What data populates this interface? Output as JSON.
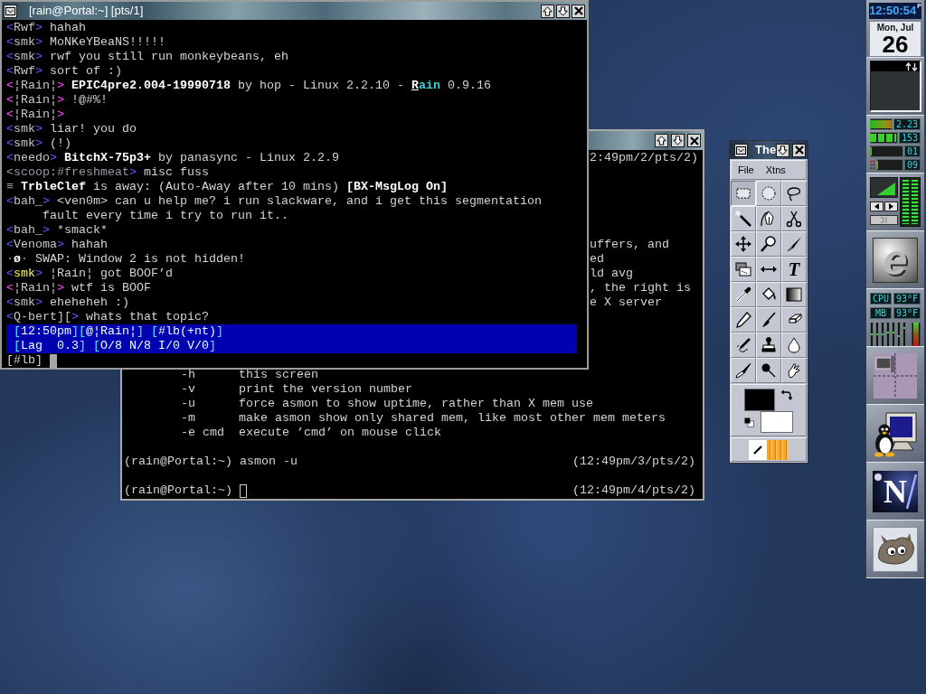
{
  "back_terminal": {
    "focused": false,
    "rows": [
      {
        "kind": "fragment",
        "text": "2:49pm/2/pts/2)"
      },
      {
        "kind": "blank"
      },
      {
        "kind": "blank"
      },
      {
        "kind": "blank"
      },
      {
        "kind": "blank"
      },
      {
        "kind": "blank"
      },
      {
        "kind": "fragment",
        "text": "uffers, and"
      },
      {
        "kind": "fragment",
        "text": "ed"
      },
      {
        "kind": "fragment",
        "text": "ld avg"
      },
      {
        "kind": "fragment",
        "text": ", the right is"
      },
      {
        "kind": "fragment",
        "text": "e X server"
      },
      {
        "kind": "blank"
      },
      {
        "kind": "blank"
      },
      {
        "kind": "blank"
      },
      {
        "kind": "blank"
      },
      {
        "kind": "option",
        "option": "-h",
        "description": "this screen"
      },
      {
        "kind": "option",
        "option": "-v",
        "description": "print the version number"
      },
      {
        "kind": "option",
        "option": "-u",
        "description": "force asmon to show uptime, rather than X mem use"
      },
      {
        "kind": "option",
        "option": "-m",
        "description": "make asmon show only shared mem, like most other mem meters"
      },
      {
        "kind": "option",
        "option": "-e cmd",
        "description": "execute ’cmd’ on mouse click"
      },
      {
        "kind": "blank"
      },
      {
        "kind": "prompt",
        "prompt": "(rain@Portal:~)",
        "command": "asmon -u",
        "info": "(12:49pm/3/pts/2)"
      },
      {
        "kind": "blank"
      },
      {
        "kind": "prompt",
        "prompt": "(rain@Portal:~)",
        "info": "(12:49pm/4/pts/2)"
      }
    ]
  },
  "front_terminal": {
    "title": "[rain@Portal:~] [pts/1]",
    "focused": true,
    "lines": [
      {
        "kind": "message",
        "segments": [
          {
            "text": "<",
            "kind": "bracket"
          },
          {
            "text": "Rwf",
            "kind": "nick"
          },
          {
            "text": ">",
            "kind": "bracket"
          },
          {
            "text": " hahah",
            "kind": "plain"
          }
        ]
      },
      {
        "kind": "message",
        "segments": [
          {
            "text": "<",
            "kind": "bracket"
          },
          {
            "text": "smk",
            "kind": "nick"
          },
          {
            "text": ">",
            "kind": "bracket"
          },
          {
            "text": " MoNKeYBeaNS!!!!!",
            "kind": "plain"
          }
        ]
      },
      {
        "kind": "message",
        "segments": [
          {
            "text": "<",
            "kind": "bracket"
          },
          {
            "text": "smk",
            "kind": "nick"
          },
          {
            "text": ">",
            "kind": "bracket"
          },
          {
            "text": " rwf you still run monkeybeans, eh",
            "kind": "plain"
          }
        ]
      },
      {
        "kind": "message",
        "segments": [
          {
            "text": "<",
            "kind": "bracket"
          },
          {
            "text": "Rwf",
            "kind": "nick"
          },
          {
            "text": ">",
            "kind": "bracket"
          },
          {
            "text": " sort of :)",
            "kind": "plain"
          }
        ]
      },
      {
        "kind": "message",
        "segments": [
          {
            "text": "<",
            "kind": "own_bracket"
          },
          {
            "text": "¦Rain¦",
            "kind": "nick"
          },
          {
            "text": ">",
            "kind": "own_bracket"
          },
          {
            "text": " EPIC4pre2.004-19990718",
            "kind": "bold"
          },
          {
            "text": " by hop - Linux 2.2.10 - ",
            "kind": "plain"
          },
          {
            "text": "R",
            "kind": "underline"
          },
          {
            "text": "ain",
            "kind": "accent"
          },
          {
            "text": " 0.9.16",
            "kind": "plain"
          }
        ]
      },
      {
        "kind": "message",
        "segments": [
          {
            "text": "<",
            "kind": "own_bracket"
          },
          {
            "text": "¦Rain¦",
            "kind": "nick"
          },
          {
            "text": ">",
            "kind": "own_bracket"
          },
          {
            "text": " !@#%!",
            "kind": "plain"
          }
        ]
      },
      {
        "kind": "message",
        "segments": [
          {
            "text": "<",
            "kind": "own_bracket"
          },
          {
            "text": "¦Rain¦",
            "kind": "nick"
          },
          {
            "text": ">",
            "kind": "own_bracket"
          }
        ]
      },
      {
        "kind": "message",
        "segments": [
          {
            "text": "<",
            "kind": "bracket"
          },
          {
            "text": "smk",
            "kind": "nick"
          },
          {
            "text": ">",
            "kind": "bracket"
          },
          {
            "text": " liar! you do",
            "kind": "plain"
          }
        ]
      },
      {
        "kind": "message",
        "segments": [
          {
            "text": "<",
            "kind": "bracket"
          },
          {
            "text": "smk",
            "kind": "nick"
          },
          {
            "text": ">",
            "kind": "bracket"
          },
          {
            "text": " (!)",
            "kind": "plain"
          }
        ]
      },
      {
        "kind": "message",
        "segments": [
          {
            "text": "<",
            "kind": "bracket"
          },
          {
            "text": "needo",
            "kind": "nick"
          },
          {
            "text": ">",
            "kind": "bracket"
          },
          {
            "text": " BitchX-75p3+",
            "kind": "bold"
          },
          {
            "text": " by panasync - Linux 2.2.9",
            "kind": "plain"
          }
        ]
      },
      {
        "kind": "message",
        "segments": [
          {
            "text": "<scoop:#freshmeat",
            "kind": "dim"
          },
          {
            "text": ">",
            "kind": "bracket"
          },
          {
            "text": " misc fuss",
            "kind": "plain"
          }
        ]
      },
      {
        "kind": "message",
        "segments": [
          {
            "text": "≡",
            "kind": "dim"
          },
          {
            "text": " TrbleClef",
            "kind": "bold"
          },
          {
            "text": " is away: (Auto-Away after 10 mins) ",
            "kind": "plain"
          },
          {
            "text": "[BX-MsgLog On]",
            "kind": "bold"
          }
        ]
      },
      {
        "kind": "message",
        "segments": [
          {
            "text": "<",
            "kind": "bracket"
          },
          {
            "text": "bah_",
            "kind": "nick"
          },
          {
            "text": ">",
            "kind": "bracket"
          },
          {
            "text": " <ven0m> can u help me? i run slackware, and i get this segmentation",
            "kind": "plain"
          }
        ]
      },
      {
        "kind": "wrap",
        "segments": [
          {
            "text": "fault every time i try to run it..",
            "kind": "plain"
          }
        ]
      },
      {
        "kind": "message",
        "segments": [
          {
            "text": "<",
            "kind": "bracket"
          },
          {
            "text": "bah_",
            "kind": "nick"
          },
          {
            "text": ">",
            "kind": "bracket"
          },
          {
            "text": " *smack*",
            "kind": "plain"
          }
        ]
      },
      {
        "kind": "message",
        "segments": [
          {
            "text": "<",
            "kind": "bracket"
          },
          {
            "text": "Venoma",
            "kind": "nick"
          },
          {
            "text": ">",
            "kind": "bracket"
          },
          {
            "text": " hahah",
            "kind": "plain"
          }
        ]
      },
      {
        "kind": "message",
        "segments": [
          {
            "text": "·",
            "kind": "dim"
          },
          {
            "text": "ø",
            "kind": "bold"
          },
          {
            "text": "·",
            "kind": "dim"
          },
          {
            "text": " SWAP: Window 2 is not hidden!",
            "kind": "plain"
          }
        ]
      },
      {
        "kind": "message",
        "segments": [
          {
            "text": "<",
            "kind": "bracket"
          },
          {
            "text": "smk",
            "kind": "highlight"
          },
          {
            "text": ">",
            "kind": "bracket"
          },
          {
            "text": " ¦Rain¦ got BOOF’d",
            "kind": "plain"
          }
        ]
      },
      {
        "kind": "message",
        "segments": [
          {
            "text": "<",
            "kind": "own_bracket"
          },
          {
            "text": "¦Rain¦",
            "kind": "nick"
          },
          {
            "text": ">",
            "kind": "own_bracket"
          },
          {
            "text": " wtf is BOOF",
            "kind": "plain"
          }
        ]
      },
      {
        "kind": "message",
        "segments": [
          {
            "text": "<",
            "kind": "bracket"
          },
          {
            "text": "smk",
            "kind": "nick"
          },
          {
            "text": ">",
            "kind": "bracket"
          },
          {
            "text": " eheheheh :)",
            "kind": "plain"
          }
        ]
      },
      {
        "kind": "message",
        "segments": [
          {
            "text": "<",
            "kind": "bracket"
          },
          {
            "text": "Q-bert][",
            "kind": "nick"
          },
          {
            "text": ">",
            "kind": "bracket"
          },
          {
            "text": " whats that topic?",
            "kind": "plain"
          }
        ]
      }
    ],
    "status_lines": [
      {
        "segments": [
          {
            "text": "[",
            "kind": "status_bracket"
          },
          {
            "text": "12:50pm",
            "kind": "status_text"
          },
          {
            "text": "][",
            "kind": "status_bracket"
          },
          {
            "text": "@¦Rain¦",
            "kind": "status_text"
          },
          {
            "text": "] [",
            "kind": "status_bracket"
          },
          {
            "text": "#lb(+nt)",
            "kind": "status_text"
          },
          {
            "text": "]",
            "kind": "status_bracket"
          }
        ]
      },
      {
        "segments": [
          {
            "text": "[",
            "kind": "status_bracket"
          },
          {
            "text": "Lag  0.3",
            "kind": "status_text"
          },
          {
            "text": "] [",
            "kind": "status_bracket"
          },
          {
            "text": "O/8 N/8 I/0 V/0",
            "kind": "status_text"
          },
          {
            "text": "]",
            "kind": "status_bracket"
          }
        ]
      }
    ],
    "prompt": "[#lb]"
  },
  "toolbox": {
    "title": "The",
    "menus": [
      "File",
      "Xtns"
    ],
    "tools": [
      {
        "kind": "rect_select",
        "selected": true
      },
      {
        "kind": "ellipse_select",
        "selected": false
      },
      {
        "kind": "lasso",
        "selected": false
      },
      {
        "kind": "magic_wand",
        "selected": false
      },
      {
        "kind": "bezier",
        "selected": false
      },
      {
        "kind": "scissors",
        "selected": false
      },
      {
        "kind": "move",
        "selected": false
      },
      {
        "kind": "magnify",
        "selected": false
      },
      {
        "kind": "crop",
        "selected": false
      },
      {
        "kind": "transform",
        "selected": false
      },
      {
        "kind": "flip",
        "selected": false
      },
      {
        "kind": "text",
        "label": "T",
        "selected": false
      },
      {
        "kind": "color_picker",
        "selected": false
      },
      {
        "kind": "bucket",
        "selected": false
      },
      {
        "kind": "blend",
        "selected": false
      },
      {
        "kind": "pencil",
        "selected": false
      },
      {
        "kind": "paintbrush",
        "selected": false
      },
      {
        "kind": "eraser",
        "selected": false
      },
      {
        "kind": "airbrush",
        "selected": false
      },
      {
        "kind": "clone",
        "selected": false
      },
      {
        "kind": "convolve",
        "selected": false
      },
      {
        "kind": "ink",
        "selected": false
      },
      {
        "kind": "dodge",
        "selected": false
      },
      {
        "kind": "smudge",
        "selected": false
      }
    ],
    "swatches": [
      {
        "kind": "foreground",
        "color": "#000000"
      },
      {
        "kind": "background",
        "color": "#ffffff"
      }
    ]
  },
  "dock": {
    "clock": {
      "time": "12:50:54",
      "meridiem": "P",
      "date": "Mon, Jul",
      "day": "26"
    },
    "meters": [
      {
        "kind": "gradient",
        "level": 0.95,
        "reading": "2.23"
      },
      {
        "kind": "segmented",
        "level": 0.95,
        "reading": "153"
      },
      {
        "kind": "gradient",
        "level": 0.06,
        "reading": "01"
      },
      {
        "kind": "alert",
        "level": 0.06,
        "reading": "09"
      }
    ],
    "mixer": {
      "channels": [
        {
          "level": 1
        },
        {
          "level": 1
        }
      ]
    },
    "logo": {
      "letter": "e"
    },
    "sensors": [
      {
        "label": "CPU",
        "reading": "93°F"
      },
      {
        "label": "MB",
        "reading": "93°F"
      }
    ],
    "sliders": [
      {
        "level": 0.5
      },
      {
        "level": 0.5
      },
      {
        "level": 0.5
      },
      {
        "level": 0.57
      },
      {
        "level": 0.58
      },
      {
        "level": 0.4
      },
      {
        "level": 0.75
      }
    ],
    "temperature": {
      "level": 1
    },
    "launcher": {
      "letter": "N"
    }
  }
}
